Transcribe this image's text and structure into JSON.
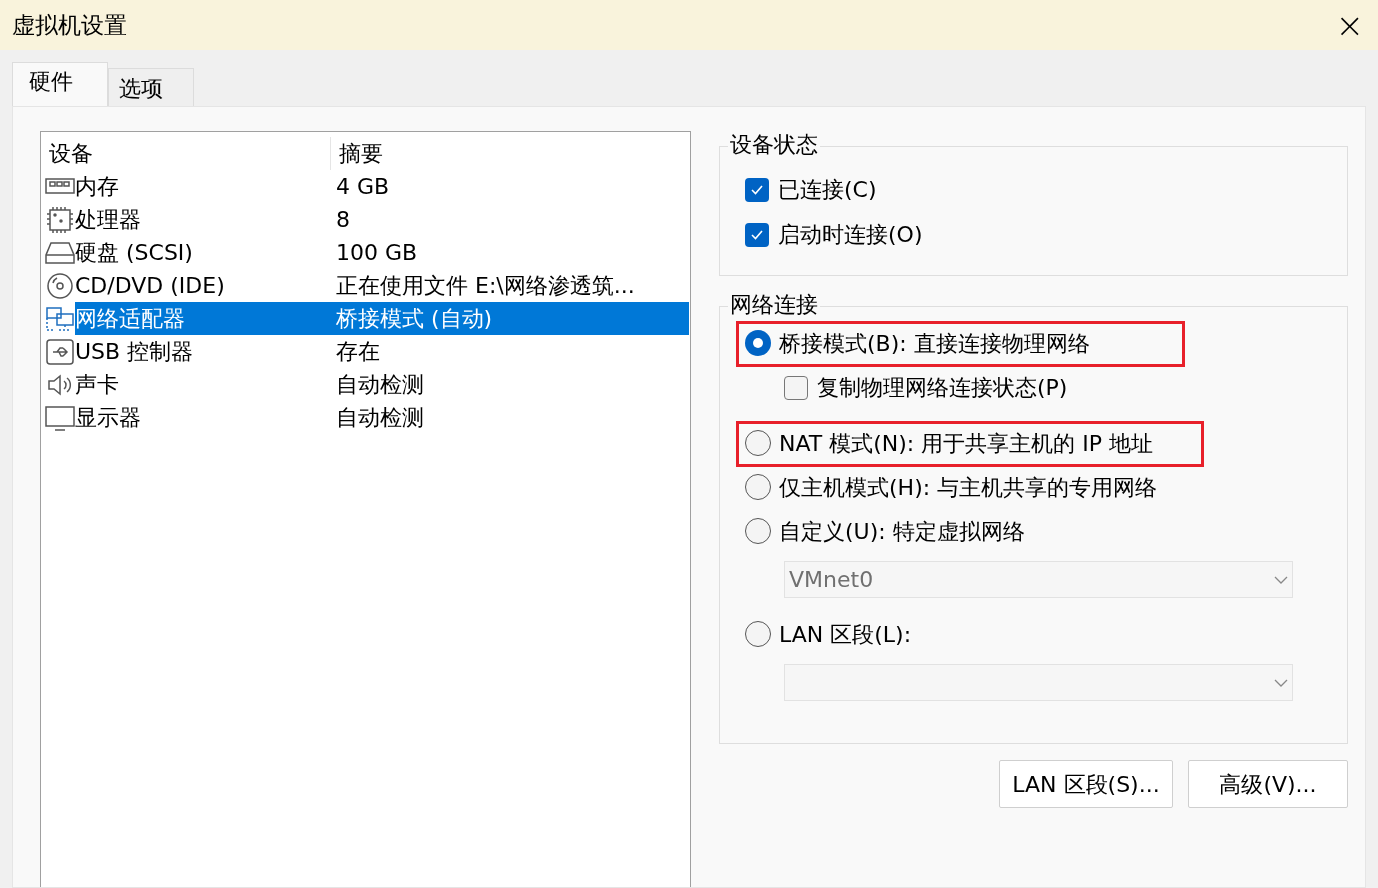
{
  "window": {
    "title": "虚拟机设置",
    "close": "×"
  },
  "tabs": [
    {
      "label": "硬件",
      "selected": true
    },
    {
      "label": "选项",
      "selected": false
    }
  ],
  "devices": {
    "columns": [
      "设备",
      "摘要"
    ],
    "rows": [
      {
        "kind": "memory",
        "device": "内存",
        "summary": "4 GB",
        "selected": false
      },
      {
        "kind": "cpu",
        "device": "处理器",
        "summary": "8",
        "selected": false
      },
      {
        "kind": "disk",
        "device": "硬盘 (SCSI)",
        "summary": "100 GB",
        "selected": false
      },
      {
        "kind": "cd",
        "device": "CD/DVD (IDE)",
        "summary": "正在使用文件 E:\\网络渗透筑...",
        "selected": false
      },
      {
        "kind": "network",
        "device": "网络适配器",
        "summary": "桥接模式 (自动)",
        "selected": true
      },
      {
        "kind": "usb",
        "device": "USB 控制器",
        "summary": "存在",
        "selected": false
      },
      {
        "kind": "sound",
        "device": "声卡",
        "summary": "自动检测",
        "selected": false
      },
      {
        "kind": "display",
        "device": "显示器",
        "summary": "自动检测",
        "selected": false
      }
    ]
  },
  "device_status": {
    "title": "设备状态",
    "checkboxes": [
      {
        "label": "已连接(C)",
        "checked": true
      },
      {
        "label": "启动时连接(O)",
        "checked": true
      }
    ]
  },
  "network_connection": {
    "title": "网络连接",
    "options": [
      {
        "label": "桥接模式(B): 直接连接物理网络",
        "selected": true,
        "highlighted": true,
        "sub": {
          "kind": "checkbox",
          "label": "复制物理网络连接状态(P)",
          "checked": false
        }
      },
      {
        "label": "NAT 模式(N): 用于共享主机的 IP 地址",
        "selected": false,
        "highlighted": true
      },
      {
        "label": "仅主机模式(H): 与主机共享的专用网络",
        "selected": false,
        "highlighted": false
      },
      {
        "label": "自定义(U): 特定虚拟网络",
        "selected": false,
        "highlighted": false,
        "sub": {
          "kind": "dropdown",
          "value": "VMnet0",
          "disabled": true
        }
      },
      {
        "label": "LAN 区段(L):",
        "selected": false,
        "highlighted": false,
        "sub": {
          "kind": "dropdown",
          "disabled": true
        }
      }
    ]
  },
  "buttons": [
    "LAN 区段(S)...",
    "高级(V)..."
  ]
}
